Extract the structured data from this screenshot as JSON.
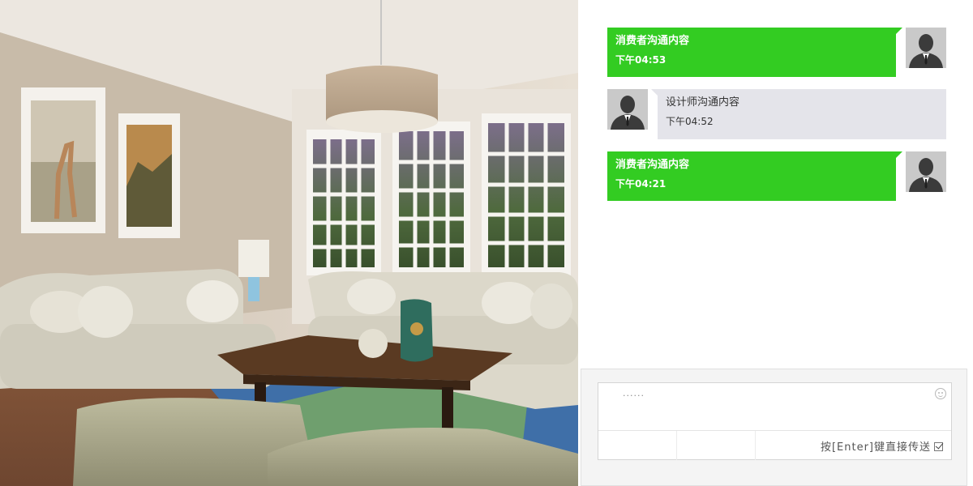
{
  "photo": {
    "scene": "living-room-rendering"
  },
  "messages": [
    {
      "role": "consumer",
      "text": "消费者沟通内容",
      "time": "下午04:53"
    },
    {
      "role": "designer",
      "text": "设计师沟通内容",
      "time": "下午04:52"
    },
    {
      "role": "consumer",
      "text": "消费者沟通内容",
      "time": "下午04:21"
    }
  ],
  "composer": {
    "value": "......",
    "send_hint": "按[Enter]键直接传送",
    "emoji_icon": "smiley-icon",
    "checkbox_icon": "checkbox-checked-icon"
  },
  "colors": {
    "outgoing_bubble": "#33cc22",
    "incoming_bubble": "#e4e4ea",
    "avatar_bg": "#c9c9c9"
  }
}
